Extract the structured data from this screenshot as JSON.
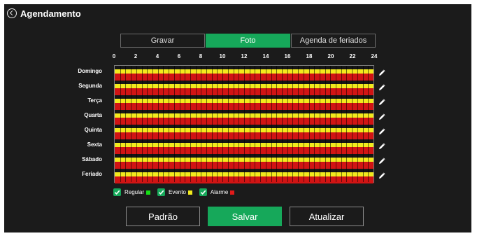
{
  "header": {
    "title": "Agendamento"
  },
  "tabs": [
    {
      "label": "Gravar",
      "active": false
    },
    {
      "label": "Foto",
      "active": true
    },
    {
      "label": "Agenda de feriados",
      "active": false
    }
  ],
  "hours": [
    "0",
    "2",
    "4",
    "6",
    "8",
    "10",
    "12",
    "14",
    "16",
    "18",
    "20",
    "22",
    "24"
  ],
  "days": [
    "Domingo",
    "Segunda",
    "Terça",
    "Quarta",
    "Quinta",
    "Sexta",
    "Sábado",
    "Feriado"
  ],
  "schedule_types": [
    {
      "label": "Regular",
      "color": "#16e016",
      "checked": true
    },
    {
      "label": "Evento",
      "color": "#f2ea1d",
      "checked": true
    },
    {
      "label": "Alarme",
      "color": "#e21a1a",
      "checked": true
    }
  ],
  "buttons": {
    "default": "Padrão",
    "save": "Salvar",
    "refresh": "Atualizar"
  }
}
